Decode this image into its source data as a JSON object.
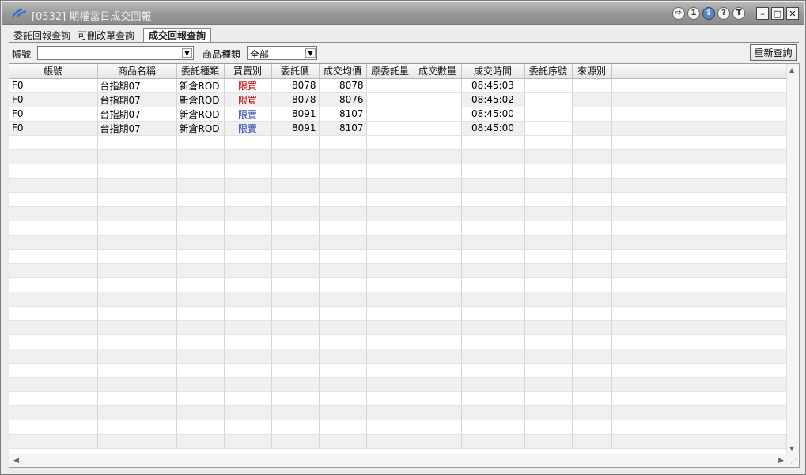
{
  "window": {
    "title": "[0532] 期權當日成交回報",
    "icons": [
      "exit-icon",
      "info-1-icon",
      "share-icon",
      "help-icon",
      "text-icon"
    ],
    "icon_glyphs": [
      "⇨",
      "1",
      "⇪",
      "?",
      "T"
    ],
    "controls": {
      "minimize": "–",
      "maximize": "□",
      "close": "✕"
    }
  },
  "tabs": [
    {
      "label": "委託回報查詢",
      "active": false
    },
    {
      "label": "可刪改單查詢",
      "active": false
    },
    {
      "label": "成交回報查詢",
      "active": true
    }
  ],
  "filters": {
    "account_label": "帳號",
    "account_value": "",
    "product_type_label": "商品種類",
    "product_type_value": "全部",
    "reload_button": "重新查詢"
  },
  "grid": {
    "columns": [
      "帳號",
      "商品名稱",
      "委託種類",
      "買賣別",
      "委託價",
      "成交均價",
      "原委託量",
      "成交數量",
      "成交時間",
      "委託序號",
      "來源別",
      ""
    ],
    "rows": [
      {
        "account": "F0",
        "product": "台指期07",
        "order_type": "新倉ROD",
        "side": "限買",
        "side_kind": "buy",
        "price": "8078",
        "avg_price": "8078",
        "orig_qty": "",
        "fill_qty": "",
        "time": "08:45:03",
        "seq": "",
        "source": ""
      },
      {
        "account": "F0",
        "product": "台指期07",
        "order_type": "新倉ROD",
        "side": "限買",
        "side_kind": "buy",
        "price": "8078",
        "avg_price": "8076",
        "orig_qty": "",
        "fill_qty": "",
        "time": "08:45:02",
        "seq": "",
        "source": ""
      },
      {
        "account": "F0",
        "product": "台指期07",
        "order_type": "新倉ROD",
        "side": "限賣",
        "side_kind": "sell",
        "price": "8091",
        "avg_price": "8107",
        "orig_qty": "",
        "fill_qty": "",
        "time": "08:45:00",
        "seq": "",
        "source": ""
      },
      {
        "account": "F0",
        "product": "台指期07",
        "order_type": "新倉ROD",
        "side": "限賣",
        "side_kind": "sell",
        "price": "8091",
        "avg_price": "8107",
        "orig_qty": "",
        "fill_qty": "",
        "time": "08:45:00",
        "seq": "",
        "source": ""
      }
    ]
  },
  "colors": {
    "buy": "#c00000",
    "sell": "#2a3fb0"
  }
}
